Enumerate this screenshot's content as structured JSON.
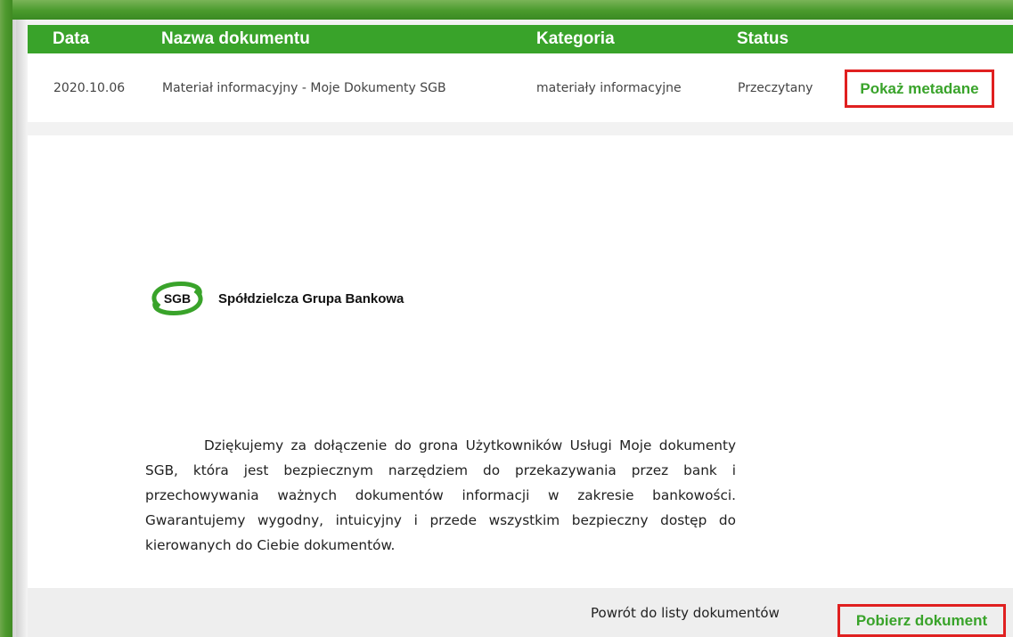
{
  "table": {
    "headers": {
      "date": "Data",
      "name": "Nazwa dokumentu",
      "category": "Kategoria",
      "status": "Status"
    },
    "row": {
      "date": "2020.10.06",
      "name": "Materiał informacyjny - Moje Dokumenty SGB",
      "category": "materiały informacyjne",
      "status": "Przeczytany",
      "action": "Pokaż metadane"
    }
  },
  "document": {
    "logo_mark": "SGB",
    "logo_text": "Spółdzielcza Grupa Bankowa",
    "paragraph": "Dziękujemy za dołączenie do grona Użytkowników Usługi Moje dokumenty SGB, która jest bezpiecznym narzędziem do przekazywania przez bank i przechowywania ważnych dokumentów informacji w zakresie bankowości. Gwarantujemy wygodny, intuicyjny i przede wszystkim bezpieczny dostęp do kierowanych do Ciebie dokumentów."
  },
  "footer": {
    "back_label": "Powrót do listy dokumentów",
    "download_label": "Pobierz dokument"
  },
  "colors": {
    "accent_green": "#39a32a",
    "highlight_red": "#e02020"
  }
}
